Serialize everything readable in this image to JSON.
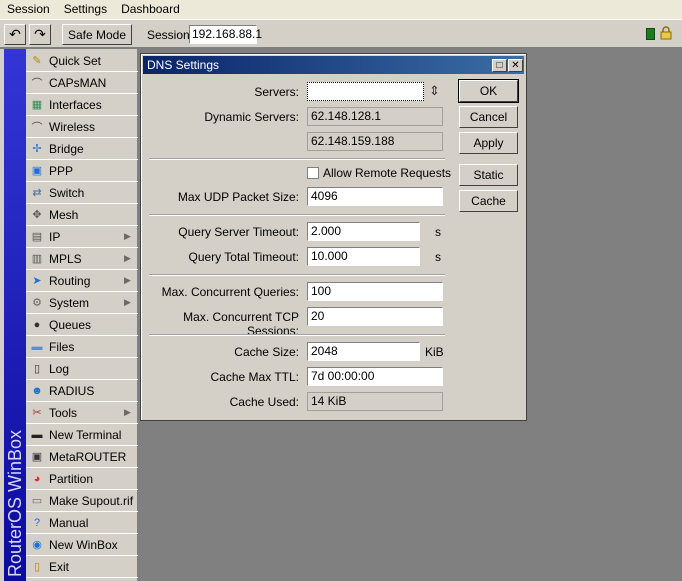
{
  "menubar": {
    "items": [
      "Session",
      "Settings",
      "Dashboard"
    ]
  },
  "toolbar": {
    "undo_glyph": "↶",
    "redo_glyph": "↷",
    "safe_mode_label": "Safe Mode",
    "session_label": "Session:",
    "session_value": "192.168.88.1"
  },
  "brand": {
    "text": "RouterOS WinBox"
  },
  "sidebar": {
    "items": [
      {
        "label": "Quick Set",
        "icon": "quick-set-icon",
        "glyph": "✎",
        "color": "#b8860b",
        "submenu": false
      },
      {
        "label": "CAPsMAN",
        "icon": "capsman-icon",
        "glyph": "⌒",
        "color": "#444444",
        "submenu": false
      },
      {
        "label": "Interfaces",
        "icon": "interfaces-icon",
        "glyph": "▦",
        "color": "#2e8b57",
        "submenu": false
      },
      {
        "label": "Wireless",
        "icon": "wireless-icon",
        "glyph": "⌒",
        "color": "#444444",
        "submenu": false
      },
      {
        "label": "Bridge",
        "icon": "bridge-icon",
        "glyph": "✢",
        "color": "#1e6fd9",
        "submenu": false
      },
      {
        "label": "PPP",
        "icon": "ppp-icon",
        "glyph": "▣",
        "color": "#1e6fd9",
        "submenu": false
      },
      {
        "label": "Switch",
        "icon": "switch-icon",
        "glyph": "⇄",
        "color": "#3a6ea5",
        "submenu": false
      },
      {
        "label": "Mesh",
        "icon": "mesh-icon",
        "glyph": "✥",
        "color": "#555555",
        "submenu": false
      },
      {
        "label": "IP",
        "icon": "ip-icon",
        "glyph": "▤",
        "color": "#555555",
        "submenu": true
      },
      {
        "label": "MPLS",
        "icon": "mpls-icon",
        "glyph": "▥",
        "color": "#555555",
        "submenu": true
      },
      {
        "label": "Routing",
        "icon": "routing-icon",
        "glyph": "➤",
        "color": "#1e6fd9",
        "submenu": true
      },
      {
        "label": "System",
        "icon": "system-icon",
        "glyph": "⚙",
        "color": "#666666",
        "submenu": true
      },
      {
        "label": "Queues",
        "icon": "queues-icon",
        "glyph": "●",
        "color": "#333333",
        "submenu": false
      },
      {
        "label": "Files",
        "icon": "files-icon",
        "glyph": "▬",
        "color": "#5b8fc7",
        "submenu": false
      },
      {
        "label": "Log",
        "icon": "log-icon",
        "glyph": "▯",
        "color": "#333333",
        "submenu": false
      },
      {
        "label": "RADIUS",
        "icon": "radius-icon",
        "glyph": "☻",
        "color": "#1a6fd9",
        "submenu": false
      },
      {
        "label": "Tools",
        "icon": "tools-icon",
        "glyph": "✂",
        "color": "#aa3333",
        "submenu": true
      },
      {
        "label": "New Terminal",
        "icon": "terminal-icon",
        "glyph": "▬",
        "color": "#222222",
        "submenu": false
      },
      {
        "label": "MetaROUTER",
        "icon": "metarouter-icon",
        "glyph": "▣",
        "color": "#333333",
        "submenu": false
      },
      {
        "label": "Partition",
        "icon": "partition-icon",
        "glyph": "◕",
        "color": "#d62d2d",
        "submenu": false
      },
      {
        "label": "Make Supout.rif",
        "icon": "supout-icon",
        "glyph": "▭",
        "color": "#666666",
        "submenu": false
      },
      {
        "label": "Manual",
        "icon": "manual-icon",
        "glyph": "?",
        "color": "#1e6fd9",
        "submenu": false
      },
      {
        "label": "New WinBox",
        "icon": "winbox-icon",
        "glyph": "◉",
        "color": "#1e6fd9",
        "submenu": false
      },
      {
        "label": "Exit",
        "icon": "exit-icon",
        "glyph": "▯",
        "color": "#b8860b",
        "submenu": false
      }
    ]
  },
  "dns": {
    "title": "DNS Settings",
    "servers_label": "Servers:",
    "servers_value": "",
    "dynamic_servers_label": "Dynamic Servers:",
    "dynamic_servers": [
      "62.148.128.1",
      "62.148.159.188"
    ],
    "allow_remote_label": "Allow Remote Requests",
    "allow_remote_checked": false,
    "max_udp_label": "Max UDP Packet Size:",
    "max_udp_value": "4096",
    "query_server_timeout_label": "Query Server Timeout:",
    "query_server_timeout_value": "2.000",
    "query_total_timeout_label": "Query Total Timeout:",
    "query_total_timeout_value": "10.000",
    "seconds_unit": "s",
    "max_concurrent_queries_label": "Max. Concurrent Queries:",
    "max_concurrent_queries_value": "100",
    "max_concurrent_tcp_label": "Max. Concurrent TCP Sessions:",
    "max_concurrent_tcp_value": "20",
    "cache_size_label": "Cache Size:",
    "cache_size_value": "2048",
    "cache_size_unit": "KiB",
    "cache_max_ttl_label": "Cache Max TTL:",
    "cache_max_ttl_value": "7d 00:00:00",
    "cache_used_label": "Cache Used:",
    "cache_used_value": "14 KiB",
    "buttons": {
      "ok": "OK",
      "cancel": "Cancel",
      "apply": "Apply",
      "static": "Static",
      "cache": "Cache"
    },
    "restore_glyph": "□",
    "close_glyph": "✕",
    "spinner_glyph": "⇕"
  }
}
